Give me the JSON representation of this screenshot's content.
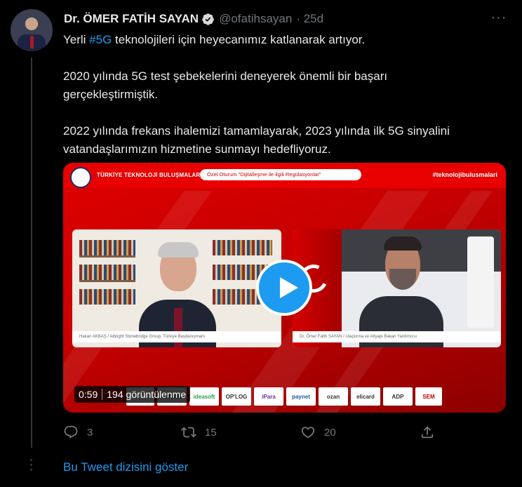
{
  "tweet": {
    "author_name": "Dr. ÖMER FATİH SAYAN",
    "handle": "@ofatihsayan",
    "time": "· 25d",
    "text": {
      "line1_prefix": "Yerli ",
      "hashtag": "#5G",
      "line1_suffix": " teknolojileri için heyecanımız katlanarak artıyor.",
      "para2": "2020 yılında 5G test şebekelerini deneyerek önemli bir başarı gerçekleştirmiştik.",
      "para3": "2022 yılında frekans ihalemizi tamamlayarak, 2023 yılında ilk 5G sinyalini vatandaşlarımızın hizmetine sunmayı hedefliyoruz."
    },
    "media": {
      "banner_title": "TÜRKİYE TEKNOLOJİ BULUŞMALARI",
      "session": "Özel Oturum  \"Dijitalleşme ile ilgili Regülasyonlar\"",
      "hashtag": "#teknolojibulusmalari",
      "caption_left": "Hakan AKBAŞ / Albright Stonebridge Group, Türkiye Başdanışmanı",
      "caption_right": "Dr. Ömer Fatih SAYAN / Ulaştırma ve Altyapı Bakan Yardımcısı",
      "sponsors": [
        "ARVAN",
        "ideasoft",
        "OP'LOG",
        "iPara",
        "paynet",
        "ozan",
        "elicard",
        "ADP",
        "SEM"
      ],
      "duration": "0:59",
      "views": "194 görüntülenme"
    },
    "actions": {
      "replies": "3",
      "retweets": "15",
      "likes": "20"
    },
    "show_thread": "Bu Tweet dizisini göster"
  },
  "colors": {
    "accent": "#1d9bf0",
    "background": "#000000",
    "muted": "#71767b"
  }
}
